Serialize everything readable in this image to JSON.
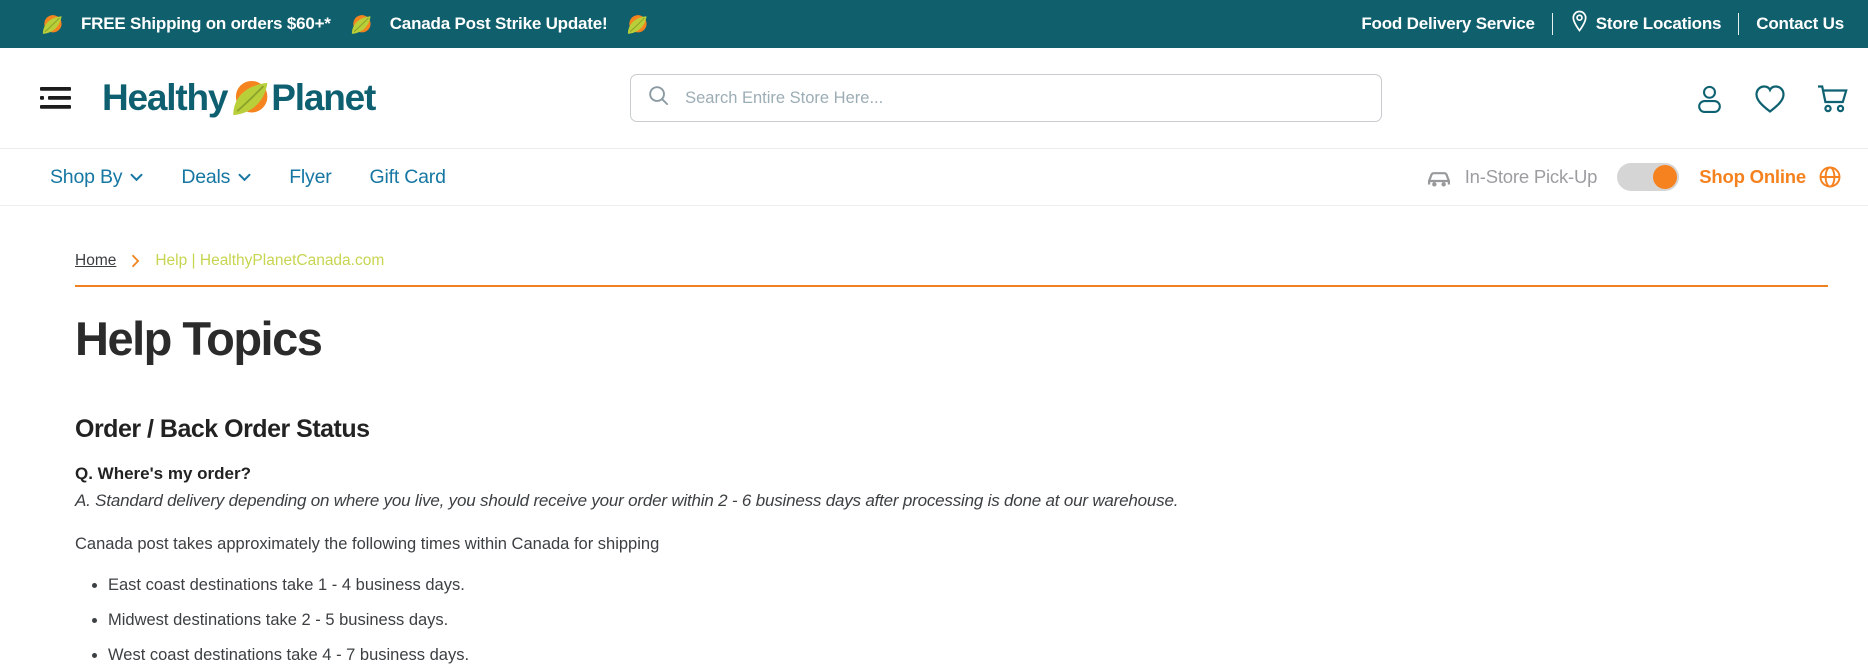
{
  "colors": {
    "top_bar_bg": "#0f5f6c",
    "brand_teal": "#0e6071",
    "nav_link_blue": "#1577a2",
    "accent_orange": "#f5811f",
    "breadcrumb_green": "#c7d551",
    "muted_gray": "#9b9da0"
  },
  "top_bar": {
    "promo1": "FREE Shipping on orders $60+*",
    "promo2": "Canada Post Strike Update!",
    "food_delivery": "Food Delivery Service",
    "store_locations": "Store Locations",
    "contact_us": "Contact Us"
  },
  "header": {
    "brand_first": "Healthy",
    "brand_second": "Planet",
    "search_placeholder": "Search Entire Store Here...",
    "search_value": ""
  },
  "nav": {
    "items": [
      {
        "label": "Shop By",
        "has_dropdown": true
      },
      {
        "label": "Deals",
        "has_dropdown": true
      },
      {
        "label": "Flyer",
        "has_dropdown": false
      },
      {
        "label": "Gift Card",
        "has_dropdown": false
      }
    ],
    "pickup_label": "In-Store Pick-Up",
    "online_label": "Shop Online",
    "toggle_state": "online"
  },
  "breadcrumb": {
    "home": "Home",
    "current": "Help | HealthyPlanetCanada.com"
  },
  "content": {
    "title": "Help Topics",
    "section_title": "Order / Back Order Status",
    "question": "Q. Where's my order?",
    "answer": "A. Standard delivery depending on where you live, you should receive your order within 2 - 6 business days after processing is done at our warehouse.",
    "intro": "Canada post takes approximately the following times within Canada for shipping",
    "bullets": [
      "East coast destinations take 1 - 4 business days.",
      "Midwest destinations take 2 - 5 business days.",
      "West coast destinations take 4 - 7 business days."
    ]
  }
}
